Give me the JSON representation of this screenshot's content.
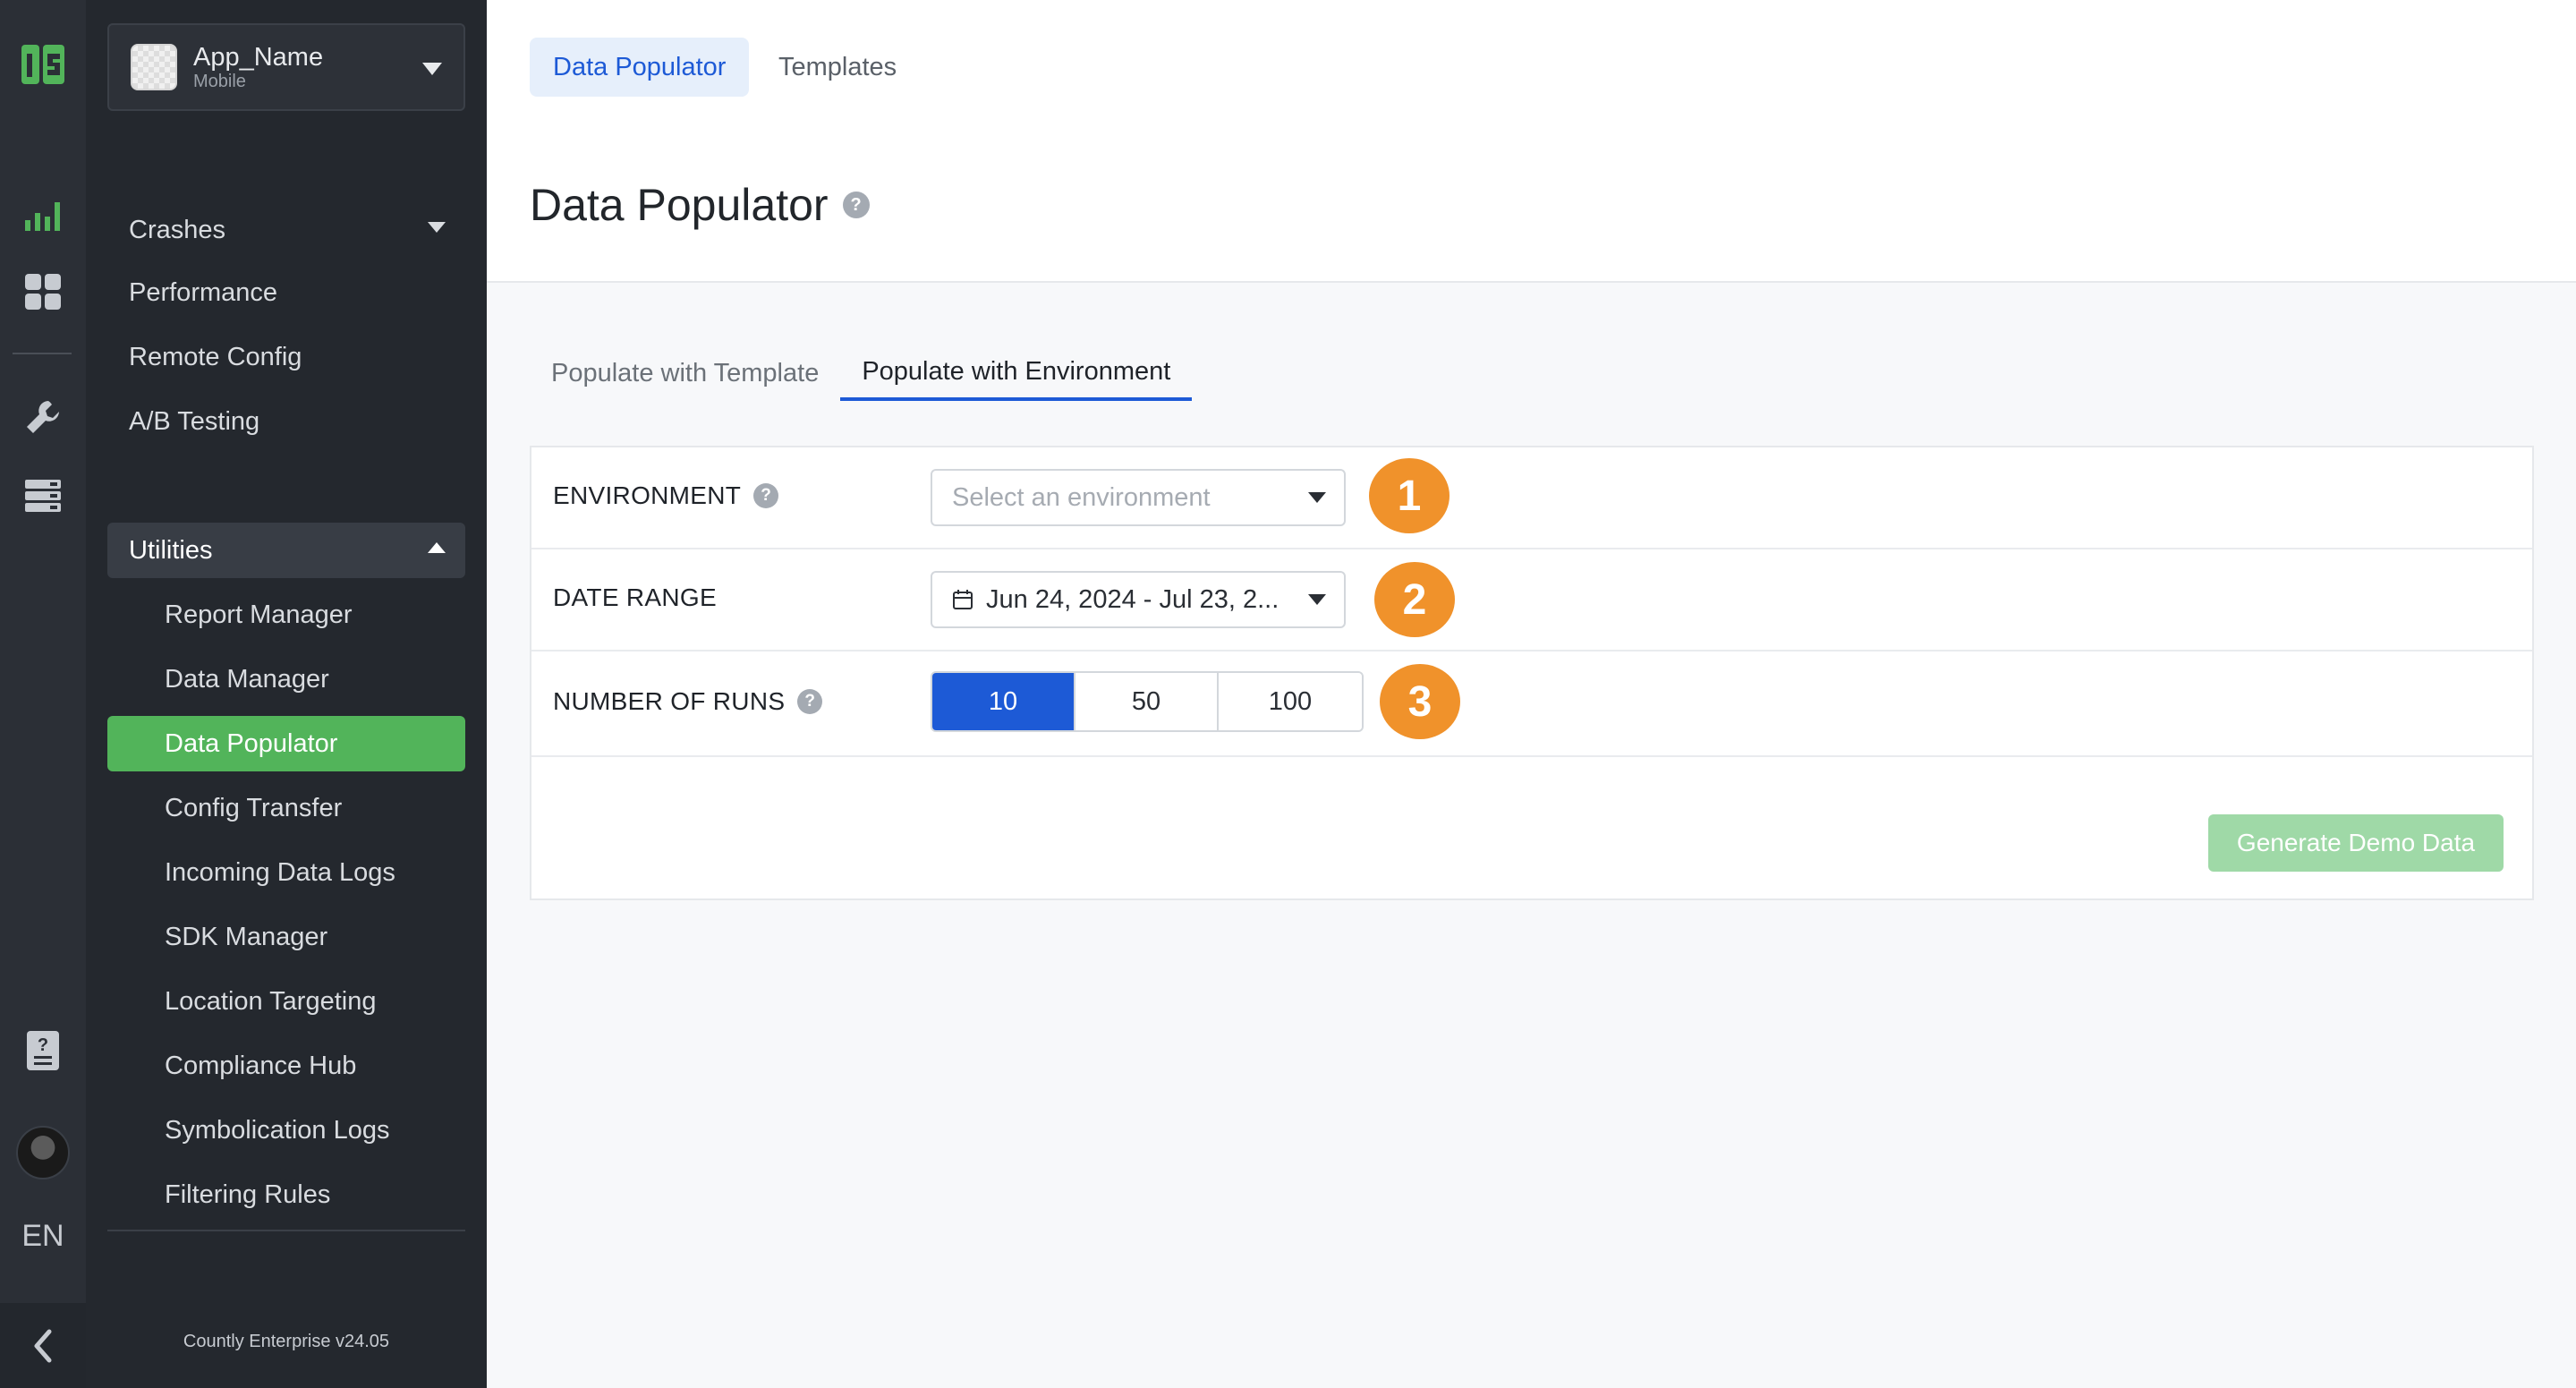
{
  "rail": {
    "lang": "EN"
  },
  "sidebar": {
    "app_name": "App_Name",
    "app_type": "Mobile",
    "items": [
      {
        "label": "Crashes"
      },
      {
        "label": "Performance"
      },
      {
        "label": "Remote Config"
      },
      {
        "label": "A/B Testing"
      }
    ],
    "group_label": "Utilities",
    "sub_items": [
      {
        "label": "Report Manager"
      },
      {
        "label": "Data Manager"
      },
      {
        "label": "Data Populator"
      },
      {
        "label": "Config Transfer"
      },
      {
        "label": "Incoming Data Logs"
      },
      {
        "label": "SDK Manager"
      },
      {
        "label": "Location Targeting"
      },
      {
        "label": "Compliance Hub"
      },
      {
        "label": "Symbolication Logs"
      },
      {
        "label": "Filtering Rules"
      }
    ],
    "active_item": "Data Populator",
    "version": "Countly Enterprise v24.05"
  },
  "header": {
    "tabs": [
      {
        "label": "Data Populator"
      },
      {
        "label": "Templates"
      }
    ],
    "title": "Data Populator"
  },
  "main": {
    "sub_tabs": [
      {
        "label": "Populate with Template"
      },
      {
        "label": "Populate with Environment"
      }
    ],
    "environment": {
      "label": "ENVIRONMENT",
      "placeholder": "Select an environment",
      "badge": "1"
    },
    "date_range": {
      "label": "DATE RANGE",
      "value": "Jun 24, 2024 - Jul 23, 2...",
      "badge": "2"
    },
    "runs": {
      "label": "NUMBER OF RUNS",
      "options": [
        "10",
        "50",
        "100"
      ],
      "selected": "10",
      "badge": "3"
    },
    "generate_button": "Generate Demo Data"
  },
  "colors": {
    "accent": "#1d5ad6",
    "active_nav": "#52b45a",
    "badge": "#f0922b",
    "button_disabled": "#9fd9a7"
  }
}
